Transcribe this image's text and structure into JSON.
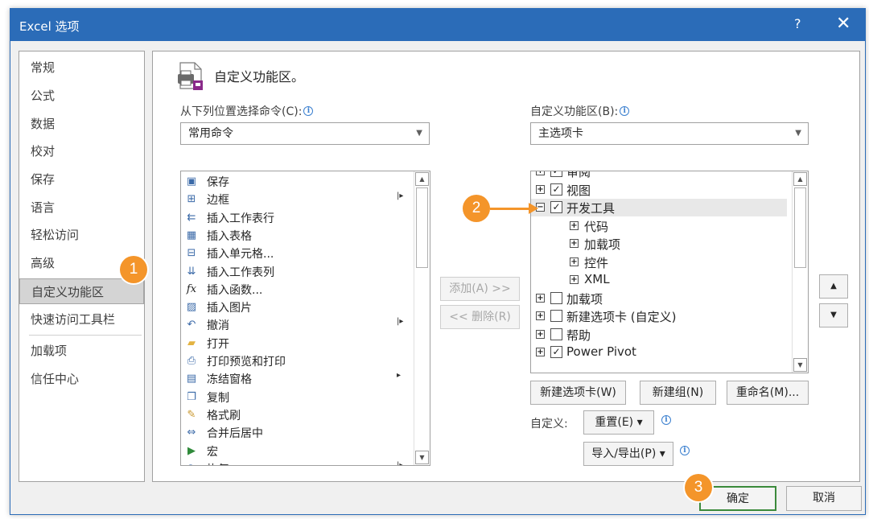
{
  "window": {
    "title": "Excel 选项",
    "help": "?",
    "close": "✕"
  },
  "nav": {
    "items": [
      "常规",
      "公式",
      "数据",
      "校对",
      "保存",
      "语言",
      "轻松访问",
      "高级",
      "自定义功能区",
      "快速访问工具栏",
      "加载项",
      "信任中心"
    ],
    "selected_index": 8
  },
  "header": {
    "text": "自定义功能区。"
  },
  "left": {
    "label": "从下列位置选择命令(C):",
    "combo_value": "常用命令",
    "commands": [
      {
        "label": "保存",
        "icon": "save-icon",
        "submenu": ""
      },
      {
        "label": "边框",
        "icon": "border-icon",
        "submenu": "|▸"
      },
      {
        "label": "插入工作表行",
        "icon": "insert-row-icon",
        "submenu": ""
      },
      {
        "label": "插入表格",
        "icon": "insert-table-icon",
        "submenu": ""
      },
      {
        "label": "插入单元格...",
        "icon": "insert-cell-icon",
        "submenu": ""
      },
      {
        "label": "插入工作表列",
        "icon": "insert-column-icon",
        "submenu": ""
      },
      {
        "label": "插入函数...",
        "icon": "function-icon",
        "submenu": ""
      },
      {
        "label": "插入图片",
        "icon": "picture-icon",
        "submenu": ""
      },
      {
        "label": "撤消",
        "icon": "undo-icon",
        "submenu": "|▸"
      },
      {
        "label": "打开",
        "icon": "folder-icon",
        "submenu": ""
      },
      {
        "label": "打印预览和打印",
        "icon": "print-preview-icon",
        "submenu": ""
      },
      {
        "label": "冻结窗格",
        "icon": "freeze-panes-icon",
        "submenu": "▸"
      },
      {
        "label": "复制",
        "icon": "copy-icon",
        "submenu": ""
      },
      {
        "label": "格式刷",
        "icon": "format-painter-icon",
        "submenu": ""
      },
      {
        "label": "合并后居中",
        "icon": "merge-center-icon",
        "submenu": ""
      },
      {
        "label": "宏",
        "icon": "macro-icon",
        "submenu": ""
      },
      {
        "label": "恢复",
        "icon": "redo-icon",
        "submenu": "|▸"
      }
    ]
  },
  "middle": {
    "add": "添加(A) >>",
    "remove": "<< 删除(R)"
  },
  "right": {
    "label": "自定义功能区(B):",
    "combo_value": "主选项卡",
    "tree": [
      {
        "label": "审阅",
        "level": 0,
        "exp": "⊞",
        "checked": true
      },
      {
        "label": "视图",
        "level": 0,
        "exp": "+",
        "checked": true
      },
      {
        "label": "开发工具",
        "level": 0,
        "exp": "−",
        "checked": true
      },
      {
        "label": "代码",
        "level": 1,
        "exp": "+"
      },
      {
        "label": "加载项",
        "level": 1,
        "exp": "+"
      },
      {
        "label": "控件",
        "level": 1,
        "exp": "+"
      },
      {
        "label": "XML",
        "level": 1,
        "exp": "+"
      },
      {
        "label": "加载项",
        "level": 0,
        "exp": "+",
        "checked": false
      },
      {
        "label": "新建选项卡 (自定义)",
        "level": 0,
        "exp": "+",
        "checked": false
      },
      {
        "label": "帮助",
        "level": 0,
        "exp": "+",
        "checked": false
      },
      {
        "label": "Power Pivot",
        "level": 0,
        "exp": "+",
        "checked": true
      }
    ],
    "new_tab": "新建选项卡(W)",
    "new_group": "新建组(N)",
    "rename": "重命名(M)...",
    "customize_label": "自定义:",
    "reset": "重置(E) ▾",
    "import_export": "导入/导出(P) ▾",
    "move_up": "▲",
    "move_down": "▼"
  },
  "footer": {
    "ok": "确定",
    "cancel": "取消"
  },
  "badges": {
    "b1": "1",
    "b2": "2",
    "b3": "3"
  },
  "colors": {
    "title_bar": "#2b6cb8",
    "badge": "#f4952a",
    "ok_border": "#3b8a3b"
  }
}
